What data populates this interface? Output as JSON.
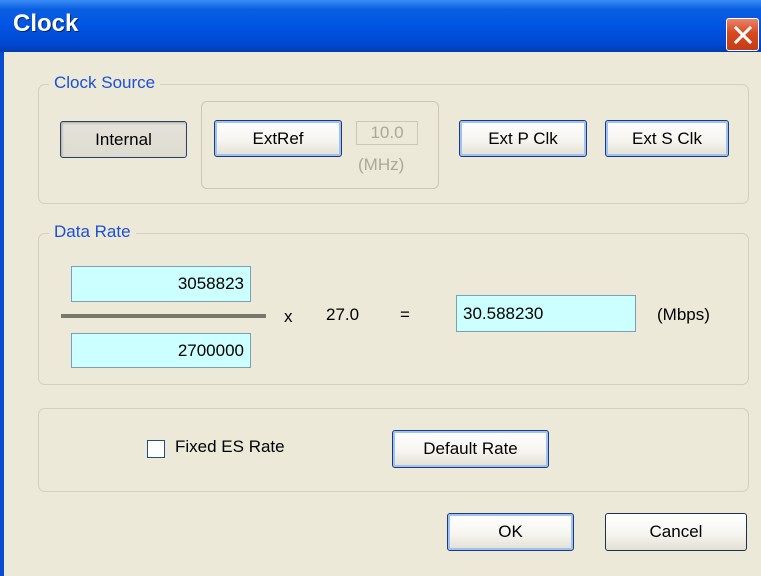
{
  "window": {
    "title": "Clock",
    "close_icon": "close-x-icon"
  },
  "clock_source": {
    "label": "Clock Source",
    "internal_label": "Internal",
    "extref_label": "ExtRef",
    "extref_freq_value": "10.0",
    "extref_unit": "(MHz)",
    "ext_p_clk_label": "Ext P Clk",
    "ext_s_clk_label": "Ext S Clk",
    "selected": "Internal"
  },
  "data_rate": {
    "label": "Data Rate",
    "numerator": "3058823",
    "denominator": "2700000",
    "multiply_sign": "x",
    "multiplier": "27.0",
    "equals_sign": "=",
    "result": "30.588230",
    "unit": "(Mbps)"
  },
  "options": {
    "fixed_es_rate_label": "Fixed ES Rate",
    "fixed_es_rate_checked": false,
    "default_rate_label": "Default Rate"
  },
  "footer": {
    "ok_label": "OK",
    "cancel_label": "Cancel"
  },
  "colors": {
    "titlebar": "#0054e3",
    "group_label": "#1c4fd6",
    "field_background": "#ccffff",
    "dialog_background": "#ece9d8"
  }
}
